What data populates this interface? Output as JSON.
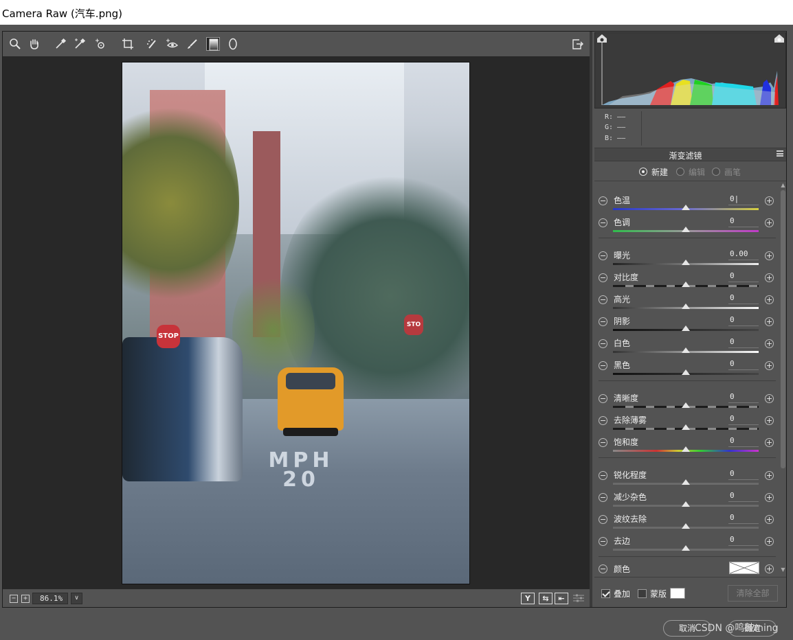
{
  "window": {
    "title": "Camera Raw (汽车.png)"
  },
  "toolbar": {
    "tools": [
      {
        "name": "zoom-tool",
        "icon": "magnifier-icon"
      },
      {
        "name": "hand-tool",
        "icon": "hand-icon"
      },
      {
        "name": "white-balance-tool",
        "icon": "eyedropper-icon"
      },
      {
        "name": "color-sampler-tool",
        "icon": "color-sampler-icon"
      },
      {
        "name": "targeted-adjustment-tool",
        "icon": "targeted-adjust-icon"
      },
      {
        "name": "crop-tool",
        "icon": "crop-icon"
      },
      {
        "name": "spot-removal-tool",
        "icon": "spot-removal-icon"
      },
      {
        "name": "red-eye-tool",
        "icon": "red-eye-icon"
      },
      {
        "name": "adjustment-brush-tool",
        "icon": "brush-icon"
      },
      {
        "name": "graduated-filter-tool",
        "icon": "graduated-filter-icon",
        "active": true
      },
      {
        "name": "radial-filter-tool",
        "icon": "radial-filter-icon"
      }
    ],
    "export_icon": "open-in-photoshop-icon"
  },
  "photo": {
    "signs": {
      "stop_left": "STOP",
      "stop_right": "STO"
    },
    "road_text": [
      "MPH",
      "20"
    ]
  },
  "statusbar": {
    "zoom_out": "−",
    "zoom_in": "+",
    "zoom_value": "86.1%",
    "zoom_dropdown": "∨",
    "view_buttons": [
      "Y",
      "⇆",
      "⇤"
    ]
  },
  "histogram": {
    "shadow_clip_icon": "shadow-clipping-warning-icon",
    "highlight_clip_icon": "highlight-clipping-warning-icon"
  },
  "rgb": {
    "r": "R:  ——",
    "g": "G:  ——",
    "b": "B:  ——"
  },
  "panel": {
    "title": "渐变滤镜",
    "modes": [
      {
        "label": "新建",
        "selected": true
      },
      {
        "label": "编辑",
        "selected": false
      },
      {
        "label": "画笔",
        "selected": false
      }
    ],
    "sliders": [
      {
        "label": "色温",
        "value": "0|",
        "track": "temp"
      },
      {
        "label": "色调",
        "value": "0",
        "track": "tint"
      },
      {
        "label": "曝光",
        "value": "0.00",
        "track": "gray"
      },
      {
        "label": "对比度",
        "value": "0",
        "track": "dash"
      },
      {
        "label": "高光",
        "value": "0",
        "track": "white"
      },
      {
        "label": "阴影",
        "value": "0",
        "track": "black"
      },
      {
        "label": "白色",
        "value": "0",
        "track": "white"
      },
      {
        "label": "黑色",
        "value": "0",
        "track": "black"
      },
      {
        "label": "清晰度",
        "value": "0",
        "track": "dash"
      },
      {
        "label": "去除薄雾",
        "value": "0",
        "track": "dash"
      },
      {
        "label": "饱和度",
        "value": "0",
        "track": "sat"
      },
      {
        "label": "锐化程度",
        "value": "0",
        "track": "flat"
      },
      {
        "label": "减少杂色",
        "value": "0",
        "track": "flat"
      },
      {
        "label": "波纹去除",
        "value": "0",
        "track": "flat"
      },
      {
        "label": "去边",
        "value": "0",
        "track": "flat"
      }
    ],
    "color_label": "颜色",
    "overlay_label": "叠加",
    "overlay_checked": true,
    "mask_label": "蒙版",
    "mask_checked": false,
    "clear_all": "清除全部"
  },
  "footer": {
    "cancel": "取消",
    "ok": "确定",
    "watermark": "CSDN @鸣鼓ming"
  },
  "colors": {
    "bg": "#535353",
    "canvas": "#282828",
    "panel": "#535353"
  }
}
